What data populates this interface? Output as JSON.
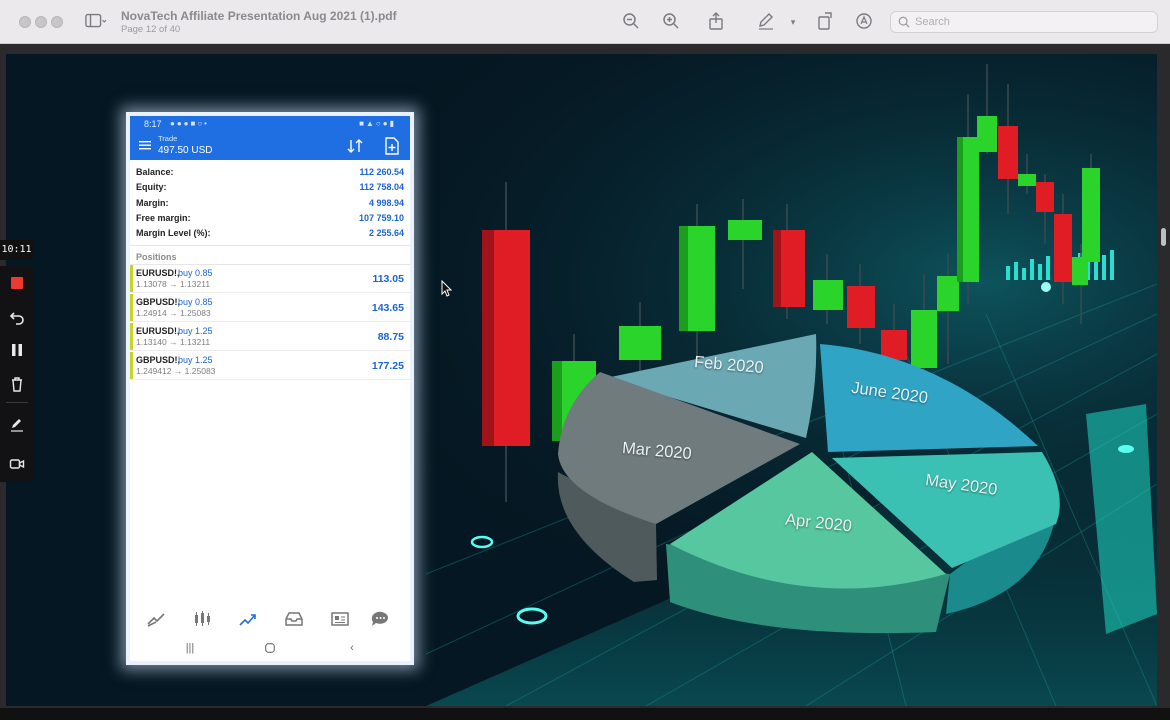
{
  "window": {
    "doc_title": "NovaTech Affiliate Presentation Aug 2021 (1).pdf",
    "page_indicator": "Page 12 of 40",
    "search_placeholder": "Search"
  },
  "recorder": {
    "elapsed": "10:11"
  },
  "phone": {
    "status_time": "8:17",
    "app_bar": {
      "subtitle": "Trade",
      "title": "497.50 USD"
    },
    "account": [
      {
        "label": "Balance:",
        "value": "112 260.54"
      },
      {
        "label": "Equity:",
        "value": "112 758.04"
      },
      {
        "label": "Margin:",
        "value": "4 998.94"
      },
      {
        "label": "Free margin:",
        "value": "107 759.10"
      },
      {
        "label": "Margin Level (%):",
        "value": "2 255.64"
      }
    ],
    "positions_header": "Positions",
    "positions": [
      {
        "symbol": "EURUSD!,",
        "direction": "buy 0.85",
        "prices": "1.13078 → 1.13211",
        "profit": "113.05"
      },
      {
        "symbol": "GBPUSD!,",
        "direction": "buy 0.85",
        "prices": "1.24914 → 1.25083",
        "profit": "143.65"
      },
      {
        "symbol": "EURUSD!,",
        "direction": "buy 1.25",
        "prices": "1.13140 → 1.13211",
        "profit": "88.75"
      },
      {
        "symbol": "GBPUSD!,",
        "direction": "buy 1.25",
        "prices": "1.249412 → 1.25083",
        "profit": "177.25"
      }
    ]
  },
  "slide": {
    "pie_labels": [
      "Feb 2020",
      "June 2020",
      "Mar 2020",
      "May 2020",
      "Apr 2020"
    ]
  },
  "colors": {
    "accent_blue": "#1f6fe3",
    "candle_green": "#2ad42a",
    "candle_red": "#e01d24",
    "slide_bg": "#051722"
  }
}
